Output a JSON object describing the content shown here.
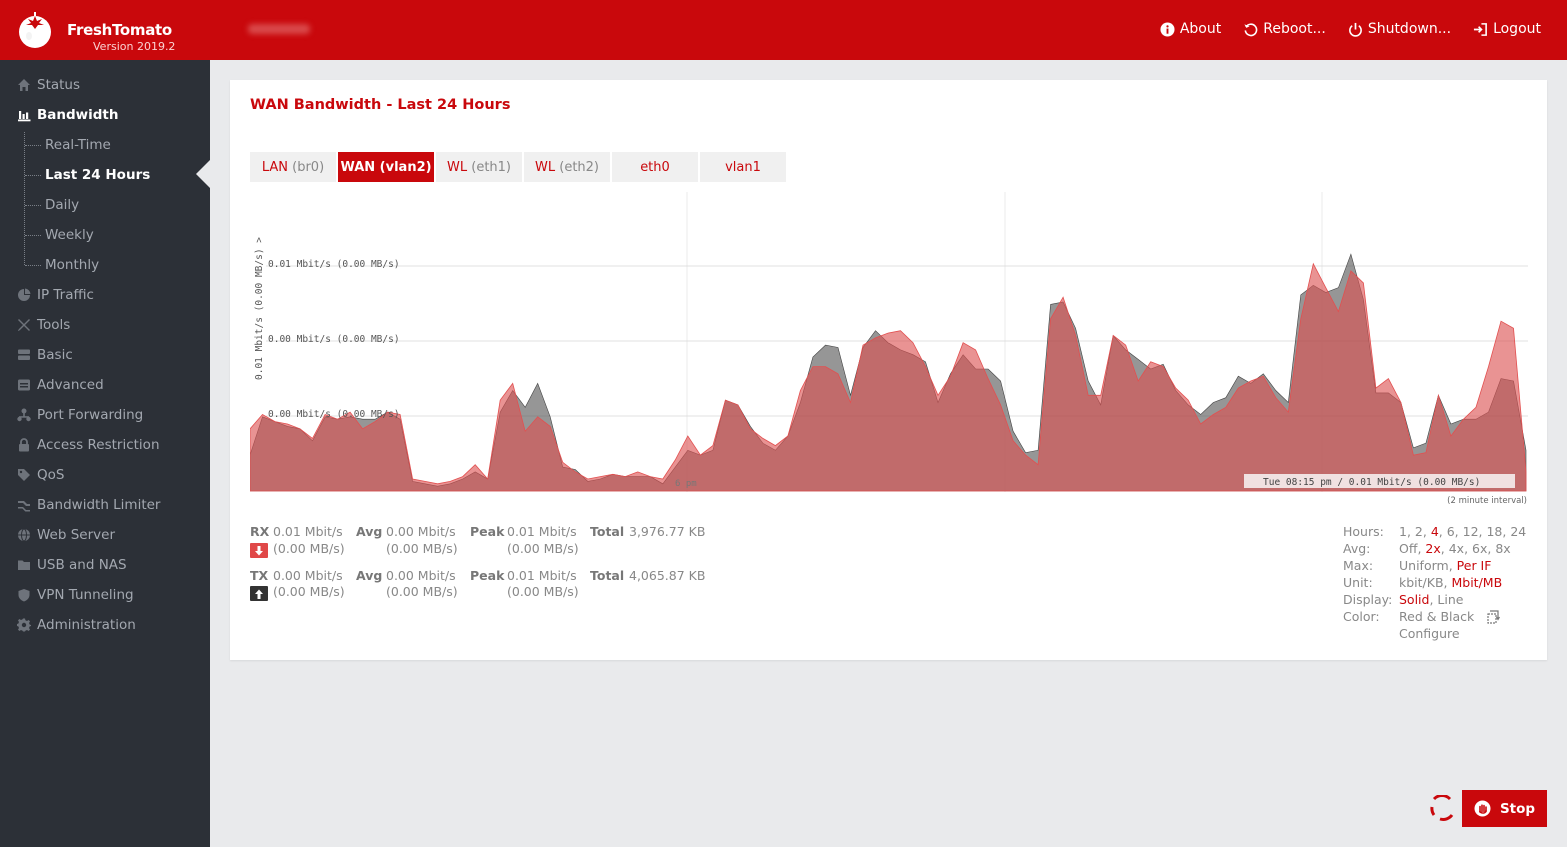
{
  "header": {
    "brand": "FreshTomato",
    "version": "Version 2019.2",
    "nav": [
      {
        "label": "About",
        "icon": "info-icon"
      },
      {
        "label": "Reboot...",
        "icon": "reboot-icon"
      },
      {
        "label": "Shutdown...",
        "icon": "power-icon"
      },
      {
        "label": "Logout",
        "icon": "logout-icon"
      }
    ]
  },
  "sidebar": {
    "items": [
      {
        "label": "Status",
        "icon": "home-icon"
      },
      {
        "label": "Bandwidth",
        "icon": "bar-chart-icon"
      },
      {
        "label": "IP Traffic",
        "icon": "pie-chart-icon"
      },
      {
        "label": "Tools",
        "icon": "tools-icon"
      },
      {
        "label": "Basic",
        "icon": "server-icon"
      },
      {
        "label": "Advanced",
        "icon": "advanced-icon"
      },
      {
        "label": "Port Forwarding",
        "icon": "network-icon"
      },
      {
        "label": "Access Restriction",
        "icon": "lock-icon"
      },
      {
        "label": "QoS",
        "icon": "tag-icon"
      },
      {
        "label": "Bandwidth Limiter",
        "icon": "limiter-icon"
      },
      {
        "label": "Web Server",
        "icon": "globe-icon"
      },
      {
        "label": "USB and NAS",
        "icon": "folder-icon"
      },
      {
        "label": "VPN Tunneling",
        "icon": "shield-icon"
      },
      {
        "label": "Administration",
        "icon": "gear-icon"
      }
    ],
    "bandwidth_sub": [
      "Real-Time",
      "Last 24 Hours",
      "Daily",
      "Weekly",
      "Monthly"
    ],
    "active_sub": "Last 24 Hours"
  },
  "panel": {
    "title": "WAN Bandwidth - Last 24 Hours",
    "tabs": [
      {
        "name": "LAN",
        "paren": "(br0)",
        "active": false
      },
      {
        "name": "WAN",
        "paren": "(vlan2)",
        "active": true
      },
      {
        "name": "WL",
        "paren": "(eth1)",
        "active": false
      },
      {
        "name": "WL",
        "paren": "(eth2)",
        "active": false
      },
      {
        "name": "eth0",
        "paren": "",
        "active": false
      },
      {
        "name": "vlan1",
        "paren": "",
        "active": false
      }
    ],
    "interval_note": "(2 minute interval)"
  },
  "chart_data": {
    "type": "area",
    "y_axis_title": "0.01 Mbit/s (0.00 MB/s) >",
    "y_tick_labels": [
      "0.01 Mbit/s (0.00 MB/s)",
      "0.00 Mbit/s (0.00 MB/s)",
      "0.00 Mbit/s (0.00 MB/s)"
    ],
    "x_tick_labels": [
      "6 pm"
    ],
    "tooltip": "Tue 08:15 pm / 0.01 Mbit/s (0.00 MB/s)",
    "unit": "Mbit/s",
    "ylim": [
      0,
      0.0125
    ],
    "grid": true,
    "series": [
      {
        "name": "RX",
        "color": "#e04848",
        "values": [
          0.0026,
          0.0032,
          0.0029,
          0.0028,
          0.0026,
          0.0022,
          0.0032,
          0.003,
          0.0033,
          0.0026,
          0.0029,
          0.0033,
          0.0032,
          0.0005,
          0.0004,
          0.0003,
          0.0004,
          0.0006,
          0.0011,
          0.0005,
          0.0038,
          0.0045,
          0.0025,
          0.0031,
          0.0027,
          0.0012,
          0.0008,
          0.0005,
          0.0006,
          0.0007,
          0.0006,
          0.0008,
          0.0006,
          0.0005,
          0.0013,
          0.0023,
          0.0015,
          0.0019,
          0.0038,
          0.0036,
          0.0026,
          0.0022,
          0.0019,
          0.0023,
          0.0042,
          0.0052,
          0.0052,
          0.0049,
          0.0037,
          0.0061,
          0.0064,
          0.0066,
          0.0067,
          0.0062,
          0.0052,
          0.004,
          0.0048,
          0.0062,
          0.0059,
          0.0047,
          0.0036,
          0.0021,
          0.0015,
          0.0011,
          0.0072,
          0.0081,
          0.0065,
          0.004,
          0.004,
          0.0065,
          0.0061,
          0.0046,
          0.0054,
          0.0052,
          0.0043,
          0.0038,
          0.0028,
          0.0032,
          0.0035,
          0.0043,
          0.0046,
          0.0048,
          0.0039,
          0.0033,
          0.0072,
          0.0095,
          0.0085,
          0.0075,
          0.0092,
          0.0087,
          0.0043,
          0.0047,
          0.0037,
          0.0015,
          0.0016,
          0.004,
          0.0023,
          0.003,
          0.0035,
          0.0052,
          0.0071,
          0.0068,
          0.0008
        ]
      },
      {
        "name": "TX",
        "color": "#222222",
        "values": [
          0.0015,
          0.0031,
          0.0029,
          0.0027,
          0.0026,
          0.0021,
          0.0031,
          0.003,
          0.0031,
          0.003,
          0.003,
          0.0033,
          0.003,
          0.0004,
          0.0003,
          0.0002,
          0.0003,
          0.0005,
          0.0008,
          0.0005,
          0.0033,
          0.0042,
          0.0035,
          0.0045,
          0.0031,
          0.001,
          0.0009,
          0.0004,
          0.0005,
          0.0007,
          0.0006,
          0.0006,
          0.0006,
          0.0003,
          0.001,
          0.0017,
          0.0015,
          0.0017,
          0.0038,
          0.0036,
          0.0027,
          0.002,
          0.0017,
          0.0023,
          0.0037,
          0.0056,
          0.0061,
          0.006,
          0.004,
          0.006,
          0.0067,
          0.0062,
          0.0059,
          0.0057,
          0.0054,
          0.0037,
          0.0049,
          0.0057,
          0.0051,
          0.0051,
          0.0046,
          0.0025,
          0.0016,
          0.0017,
          0.0078,
          0.0079,
          0.0068,
          0.0046,
          0.0036,
          0.0065,
          0.0059,
          0.0055,
          0.0051,
          0.0053,
          0.0042,
          0.0036,
          0.0032,
          0.0037,
          0.0039,
          0.0048,
          0.0045,
          0.0049,
          0.0042,
          0.0037,
          0.0082,
          0.0086,
          0.0083,
          0.0085,
          0.0099,
          0.008,
          0.0041,
          0.0041,
          0.0037,
          0.0018,
          0.002,
          0.004,
          0.0028,
          0.003,
          0.003,
          0.0033,
          0.0047,
          0.0046,
          0.0017
        ]
      }
    ]
  },
  "stats": {
    "rx": {
      "label": "RX",
      "rate": "0.01 Mbit/s",
      "rate_mb": "(0.00 MB/s)",
      "avg_label": "Avg",
      "avg": "0.00 Mbit/s",
      "avg_mb": "(0.00 MB/s)",
      "peak_label": "Peak",
      "peak": "0.01 Mbit/s",
      "peak_mb": "(0.00 MB/s)",
      "total_label": "Total",
      "total": "3,976.77 KB",
      "color": "#e04848"
    },
    "tx": {
      "label": "TX",
      "rate": "0.00 Mbit/s",
      "rate_mb": "(0.00 MB/s)",
      "avg_label": "Avg",
      "avg": "0.00 Mbit/s",
      "avg_mb": "(0.00 MB/s)",
      "peak_label": "Peak",
      "peak": "0.01 Mbit/s",
      "peak_mb": "(0.00 MB/s)",
      "total_label": "Total",
      "total": "4,065.87 KB",
      "color": "#333333"
    }
  },
  "options": {
    "hours": {
      "label": "Hours:",
      "values": [
        "1",
        "2",
        "4",
        "6",
        "12",
        "18",
        "24"
      ],
      "selected": "4"
    },
    "avg": {
      "label": "Avg:",
      "values": [
        "Off",
        "2x",
        "4x",
        "6x",
        "8x"
      ],
      "selected": "2x"
    },
    "max": {
      "label": "Max:",
      "values": [
        "Uniform",
        "Per IF"
      ],
      "selected": "Per IF"
    },
    "unit": {
      "label": "Unit:",
      "values": [
        "kbit/KB",
        "Mbit/MB"
      ],
      "selected": "Mbit/MB"
    },
    "display": {
      "label": "Display:",
      "values": [
        "Solid",
        "Line"
      ],
      "selected": "Solid"
    },
    "color": {
      "label": "Color:",
      "value": "Red & Black"
    },
    "configure": "Configure"
  },
  "footer": {
    "stop_label": "Stop"
  }
}
